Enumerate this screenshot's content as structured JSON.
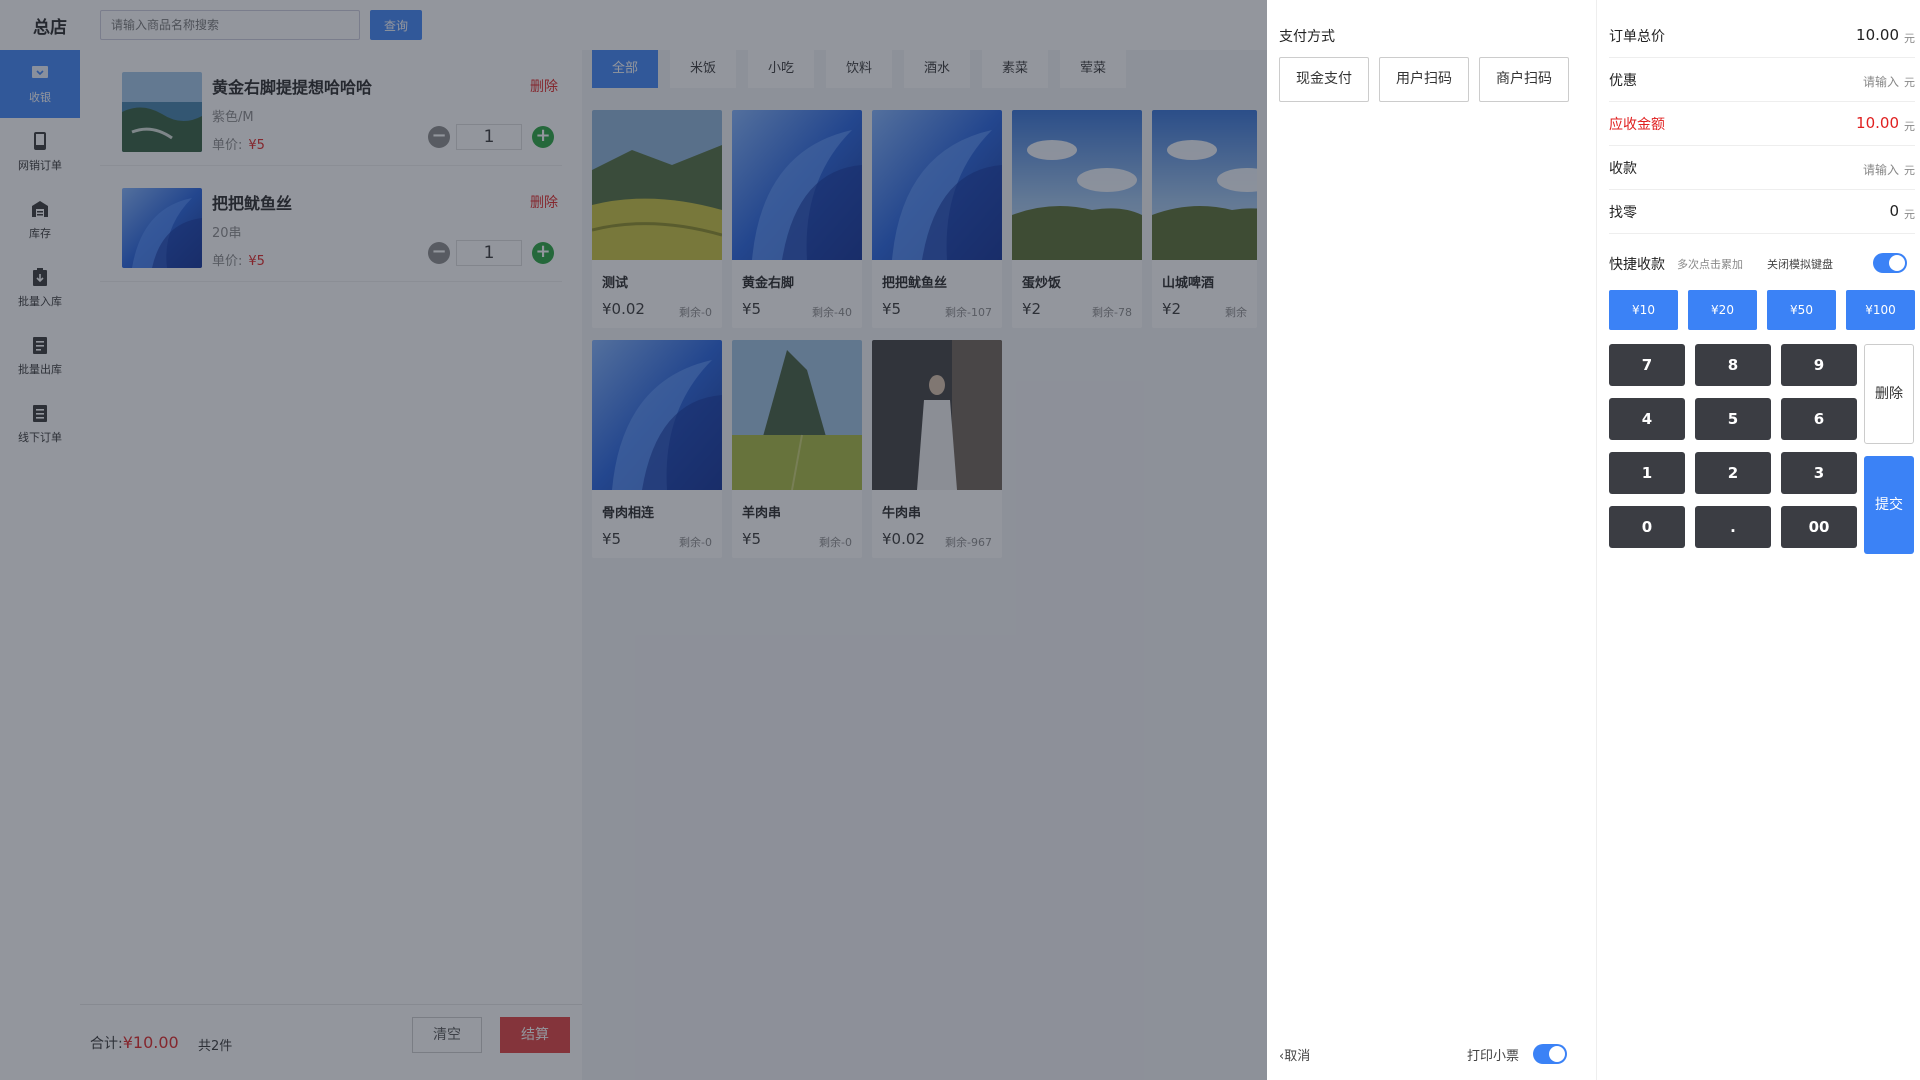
{
  "header": {
    "store_name": "总店",
    "search_placeholder": "请输入商品名称搜索",
    "search_button": "查询"
  },
  "sidebar": {
    "items": [
      {
        "label": "收银",
        "icon": "cashier-icon",
        "active": true
      },
      {
        "label": "网销订单",
        "icon": "phone-icon",
        "active": false
      },
      {
        "label": "库存",
        "icon": "warehouse-icon",
        "active": false
      },
      {
        "label": "批量入库",
        "icon": "clipboard-in-icon",
        "active": false
      },
      {
        "label": "批量出库",
        "icon": "clipboard-out-icon",
        "active": false
      },
      {
        "label": "线下订单",
        "icon": "order-list-icon",
        "active": false
      }
    ]
  },
  "cart": {
    "delete_label": "删除",
    "unit_price_label": "单价:",
    "items": [
      {
        "name": "黄金右脚提提想哈哈哈",
        "spec": "紫色/M",
        "price": "¥5",
        "qty": "1",
        "image": "coast-landscape"
      },
      {
        "name": "把把鱿鱼丝",
        "spec": "20串",
        "price": "¥5",
        "qty": "1",
        "image": "blue-bloom"
      }
    ],
    "footer": {
      "total_label": "合计:",
      "total_amount": "¥10.00",
      "count": "共2件",
      "clear_label": "清空",
      "checkout_label": "结算"
    }
  },
  "categories": [
    "全部",
    "米饭",
    "小吃",
    "饮料",
    "酒水",
    "素菜",
    "荤菜"
  ],
  "products": [
    {
      "name": "测试",
      "price": "¥0.02",
      "stock": "剩余-0",
      "image": "terraces"
    },
    {
      "name": "黄金右脚",
      "price": "¥5",
      "stock": "剩余-40",
      "image": "blue-bloom"
    },
    {
      "name": "把把鱿鱼丝",
      "price": "¥5",
      "stock": "剩余-107",
      "image": "blue-bloom"
    },
    {
      "name": "蛋炒饭",
      "price": "¥2",
      "stock": "剩余-78",
      "image": "sky-hills"
    },
    {
      "name": "山城啤酒",
      "price": "¥2",
      "stock": "剩余",
      "image": "sky-hills"
    },
    {
      "name": "骨肉相连",
      "price": "¥5",
      "stock": "剩余-0",
      "image": "blue-bloom"
    },
    {
      "name": "羊肉串",
      "price": "¥5",
      "stock": "剩余-0",
      "image": "karst-field"
    },
    {
      "name": "牛肉串",
      "price": "¥0.02",
      "stock": "剩余-967",
      "image": "interior-person"
    }
  ],
  "payment": {
    "title": "支付方式",
    "options": [
      "现金支付",
      "用户扫码",
      "商户扫码"
    ],
    "cancel_label": "取消",
    "print_label": "打印小票",
    "print_enabled": true
  },
  "summary": {
    "order_total_label": "订单总价",
    "order_total_value": "10.00",
    "discount_label": "优惠",
    "discount_placeholder": "请输入",
    "receivable_label": "应收金额",
    "receivable_value": "10.00",
    "received_label": "收款",
    "received_placeholder": "请输入",
    "change_label": "找零",
    "change_value": "0",
    "unit": "元"
  },
  "quick": {
    "label": "快捷收款",
    "hint": "多次点击累加",
    "keyboard_label": "关闭模拟键盘",
    "keyboard_enabled": true,
    "amounts": [
      "¥10",
      "¥20",
      "¥50",
      "¥100"
    ]
  },
  "keypad": {
    "keys": [
      "7",
      "8",
      "9",
      "4",
      "5",
      "6",
      "1",
      "2",
      "3",
      "0",
      ".",
      "00"
    ],
    "delete_label": "删除",
    "submit_label": "提交"
  },
  "colors": {
    "primary": "#3b82f6",
    "danger": "#e02020",
    "success": "#22a33a",
    "key_dark": "#3b3d43"
  }
}
